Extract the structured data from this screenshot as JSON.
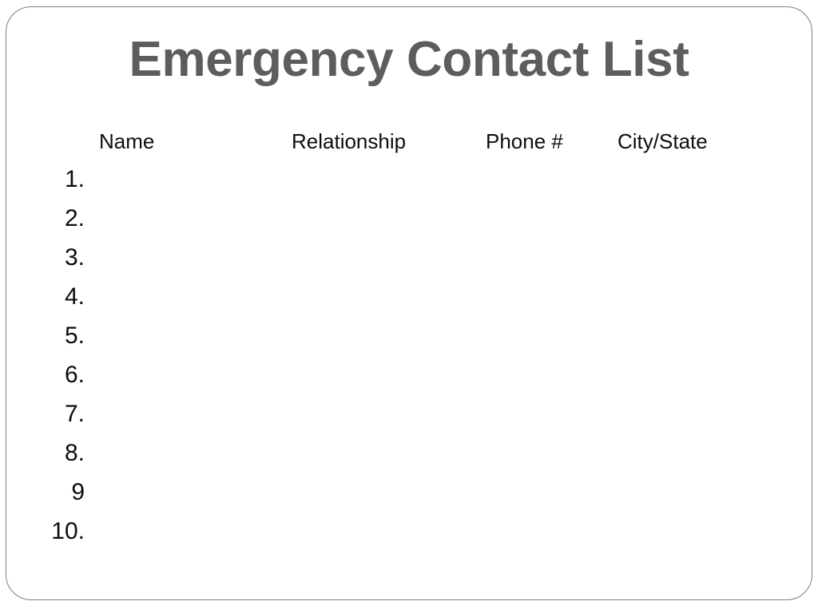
{
  "slide": {
    "title": "Emergency Contact List",
    "title_color": "#5f5d5b",
    "frame_border_color": "#7d7d7d",
    "background_color": "#ffffff",
    "text_color": "#0d0d0d"
  },
  "table": {
    "headers": [
      {
        "key": "name",
        "label": "Name"
      },
      {
        "key": "relationship",
        "label": "Relationship"
      },
      {
        "key": "phone",
        "label": "Phone #"
      },
      {
        "key": "citystate",
        "label": "City/State"
      }
    ],
    "rows": [
      {
        "number": "1.",
        "name": "",
        "relationship": "",
        "phone": "",
        "citystate": ""
      },
      {
        "number": "2.",
        "name": "",
        "relationship": "",
        "phone": "",
        "citystate": ""
      },
      {
        "number": "3.",
        "name": "",
        "relationship": "",
        "phone": "",
        "citystate": ""
      },
      {
        "number": "4.",
        "name": "",
        "relationship": "",
        "phone": "",
        "citystate": ""
      },
      {
        "number": "5.",
        "name": "",
        "relationship": "",
        "phone": "",
        "citystate": ""
      },
      {
        "number": "6.",
        "name": "",
        "relationship": "",
        "phone": "",
        "citystate": ""
      },
      {
        "number": "7.",
        "name": "",
        "relationship": "",
        "phone": "",
        "citystate": ""
      },
      {
        "number": "8.",
        "name": "",
        "relationship": "",
        "phone": "",
        "citystate": ""
      },
      {
        "number": "9",
        "name": "",
        "relationship": "",
        "phone": "",
        "citystate": ""
      },
      {
        "number": "10.",
        "name": "",
        "relationship": "",
        "phone": "",
        "citystate": ""
      }
    ]
  }
}
